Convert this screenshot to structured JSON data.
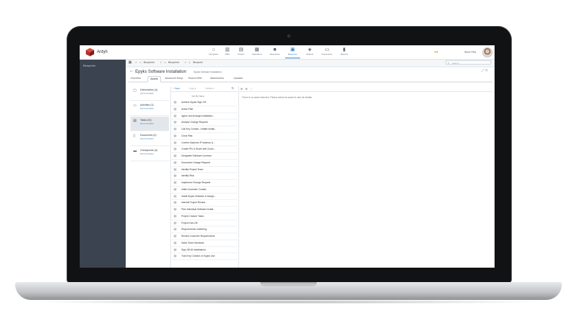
{
  "app": {
    "name": "Ardyh"
  },
  "topnav": {
    "items": [
      {
        "label": "My Space",
        "icon": "home-icon",
        "glyph": "⌂",
        "active": false
      },
      {
        "label": "PMO",
        "icon": "building-icon",
        "glyph": "▥",
        "active": false
      },
      {
        "label": "Project",
        "icon": "document-icon",
        "glyph": "▤",
        "active": false
      },
      {
        "label": "Operations",
        "icon": "factory-icon",
        "glyph": "▦",
        "active": false
      },
      {
        "label": "Resources",
        "icon": "people-icon",
        "glyph": "☻",
        "active": false
      },
      {
        "label": "Blueprints",
        "icon": "blueprint-icon",
        "glyph": "▣",
        "active": true
      },
      {
        "label": "Objects",
        "icon": "cube-icon",
        "glyph": "◈",
        "active": false
      },
      {
        "label": "Documents",
        "icon": "folder-icon",
        "glyph": "▭",
        "active": false
      },
      {
        "label": "Reports",
        "icon": "chart-icon",
        "glyph": "▮",
        "active": false
      }
    ],
    "coins_glyph": "●●",
    "user_name": "Steve Pink"
  },
  "sidebar": {
    "label": "Blueprints"
  },
  "breadcrumb": {
    "grid_glyph": "▦",
    "items": [
      "Blueprints",
      "Blueprints",
      "Blueprint"
    ],
    "sep": ">"
  },
  "search": {
    "placeholder": "Search..."
  },
  "page": {
    "back_glyph": "←",
    "title": "Epyks Software Installation",
    "subtitle": "Epyks Software Installation",
    "window_glyphs": "⤢ ✕"
  },
  "tabs": [
    {
      "label": "Overview",
      "active": false
    },
    {
      "label": "Assets",
      "active": true
    },
    {
      "label": "Advanced Setup",
      "active": false
    },
    {
      "label": "Shared With",
      "active": false
    },
    {
      "label": "Attachments",
      "active": false
    },
    {
      "label": "Updates",
      "active": false
    }
  ],
  "categories": [
    {
      "name": "Deliverables (4)",
      "sub": "(0) Incomplete",
      "glyph": "▢",
      "icon": "deliverables-icon",
      "active": false
    },
    {
      "name": "Activities (3)",
      "sub": "(0) Incomplete",
      "glyph": "▭",
      "icon": "activities-icon",
      "active": false
    },
    {
      "name": "Tasks (24)",
      "sub": "(0) Incomplete",
      "glyph": "▤",
      "icon": "tasks-icon",
      "active": true
    },
    {
      "name": "Documents (0)",
      "sub": "(0) Incomplete",
      "glyph": "▯",
      "icon": "documents-icon",
      "active": false
    },
    {
      "name": "Checkpoints (4)",
      "sub": "(0) Incomplete",
      "glyph": "▬",
      "icon": "checkpoints-icon",
      "active": false
    }
  ],
  "list_toolbar": {
    "new_label": "+ New",
    "copy_label": "Copy ▾",
    "delete_label": "Delete ▾",
    "refresh_glyph": "↻",
    "sort_label": "Sort By Name"
  },
  "tasks": [
    "Achieve Epyks Sign-Off",
    "Action Risk",
    "Agree and Arrange installation...",
    "Analyse Change Request",
    "Call Key Contact - Initiate Install...",
    "Close Risk",
    "Confirm Machine IP Address &...",
    "Create PID & Share with Custo...",
    "Designate Software Licences",
    "Document Change Request",
    "Identify Project Team",
    "Identify Risk",
    "Implement Change Request",
    "Initial Customer Contact",
    "Install Epyks Software & Assign...",
    "Internal Project Review",
    "Plan Individual Software Install...",
    "Project Closure Tasks",
    "Project Kick-Off",
    "Requirements Gathering",
    "Review Customer Requirements",
    "Sales Team Handover",
    "Sign-Off All Installations",
    "Train Key Contact on Epyks Use"
  ],
  "task_glyph": "▤",
  "detail": {
    "toolbar_glyphs": [
      "☰",
      "⚙",
      "⋮"
    ],
    "message": "There is no asset selected. Please select an asset to view its details."
  }
}
